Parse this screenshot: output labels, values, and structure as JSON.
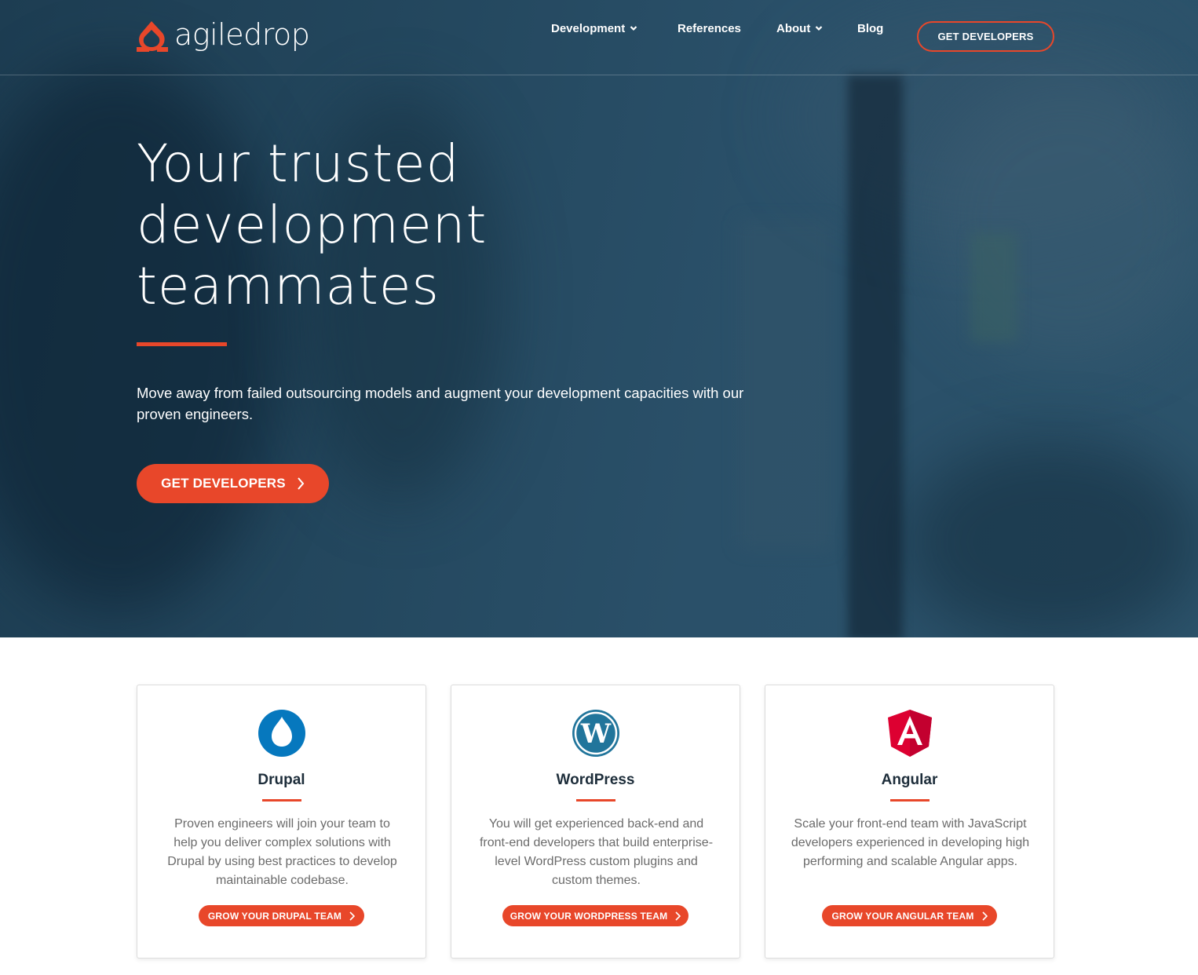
{
  "brand": {
    "name": "agiledrop",
    "accent_color": "#e8472a"
  },
  "nav": {
    "items": [
      {
        "label": "Development",
        "has_dropdown": true
      },
      {
        "label": "References",
        "has_dropdown": false
      },
      {
        "label": "About",
        "has_dropdown": true
      },
      {
        "label": "Blog",
        "has_dropdown": false
      }
    ],
    "cta_label": "GET DEVELOPERS"
  },
  "hero": {
    "title_lines": [
      "Your trusted",
      "development",
      "teammates"
    ],
    "subtitle": "Move away from failed outsourcing models and augment your development capacities with our proven engineers.",
    "cta_label": "GET DEVELOPERS"
  },
  "cards": [
    {
      "icon": "drupal-icon",
      "title": "Drupal",
      "description": "Proven engineers will join your team to help you deliver complex solutions with Drupal by using best practices to develop maintainable codebase.",
      "button_label": "GROW YOUR DRUPAL TEAM"
    },
    {
      "icon": "wordpress-icon",
      "title": "WordPress",
      "description": "You will get experienced back-end and front-end developers that build enterprise-level WordPress custom plugins and custom themes.",
      "button_label": "GROW YOUR WORDPRESS TEAM"
    },
    {
      "icon": "angular-icon",
      "title": "Angular",
      "description": "Scale your front-end team with JavaScript developers experienced in developing high performing and scalable Angular apps.",
      "button_label": "GROW YOUR ANGULAR TEAM"
    }
  ]
}
